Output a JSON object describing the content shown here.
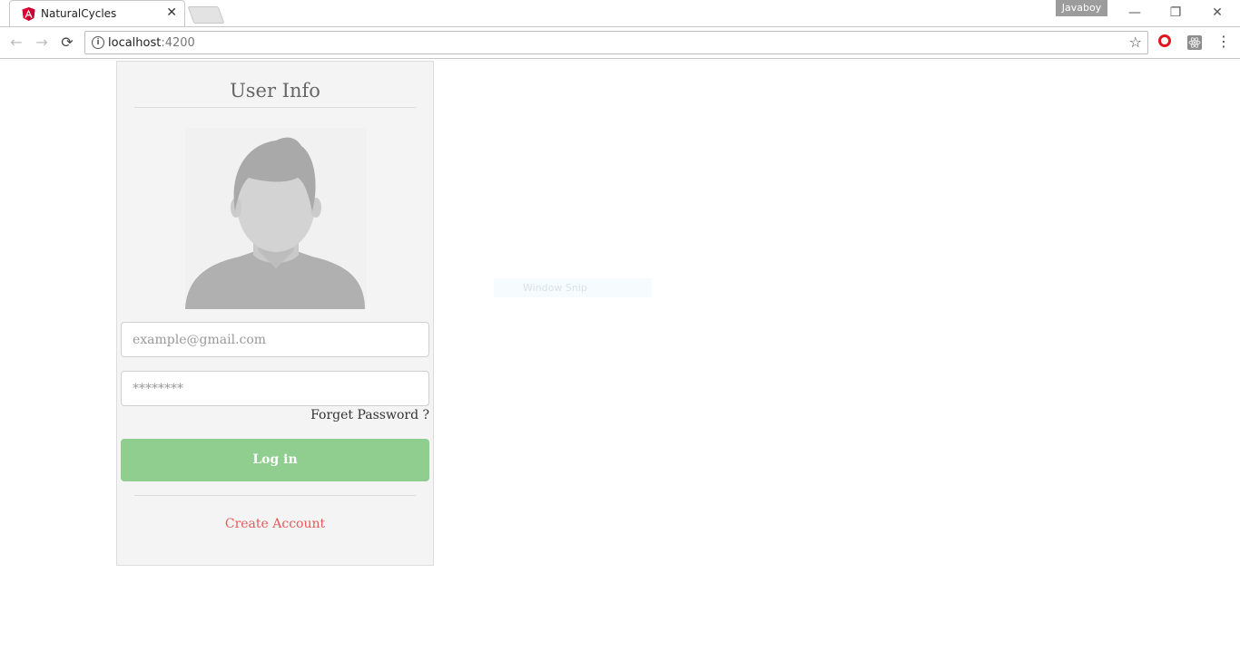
{
  "browser": {
    "tab_title": "NaturalCycles",
    "tab_close": "✕",
    "profile_name": "Javaboy",
    "window_controls": {
      "minimize": "—",
      "restore": "❐",
      "close": "✕"
    },
    "nav": {
      "back": "←",
      "forward": "→",
      "reload": "⟳"
    },
    "url_host": "localhost",
    "url_port": ":4200",
    "info_icon": "i",
    "bookmark_star": "☆",
    "menu": "⋮",
    "icons": [
      "angular-favicon-icon",
      "info-icon",
      "star-icon",
      "opera-icon",
      "react-devtools-icon",
      "menu-icon"
    ],
    "accent_color": "#dd0031"
  },
  "page": {
    "title": "User Info",
    "email_placeholder": "example@gmail.com",
    "password_placeholder": "********",
    "forgot_label": "Forget Password ?",
    "login_label": "Log in",
    "create_label": "Create Account",
    "colors": {
      "login_button": "#8fce8f",
      "create_link": "#e25b5b",
      "card_bg": "#f4f4f4"
    }
  },
  "overlay": {
    "snip_label": "Window Snip"
  }
}
